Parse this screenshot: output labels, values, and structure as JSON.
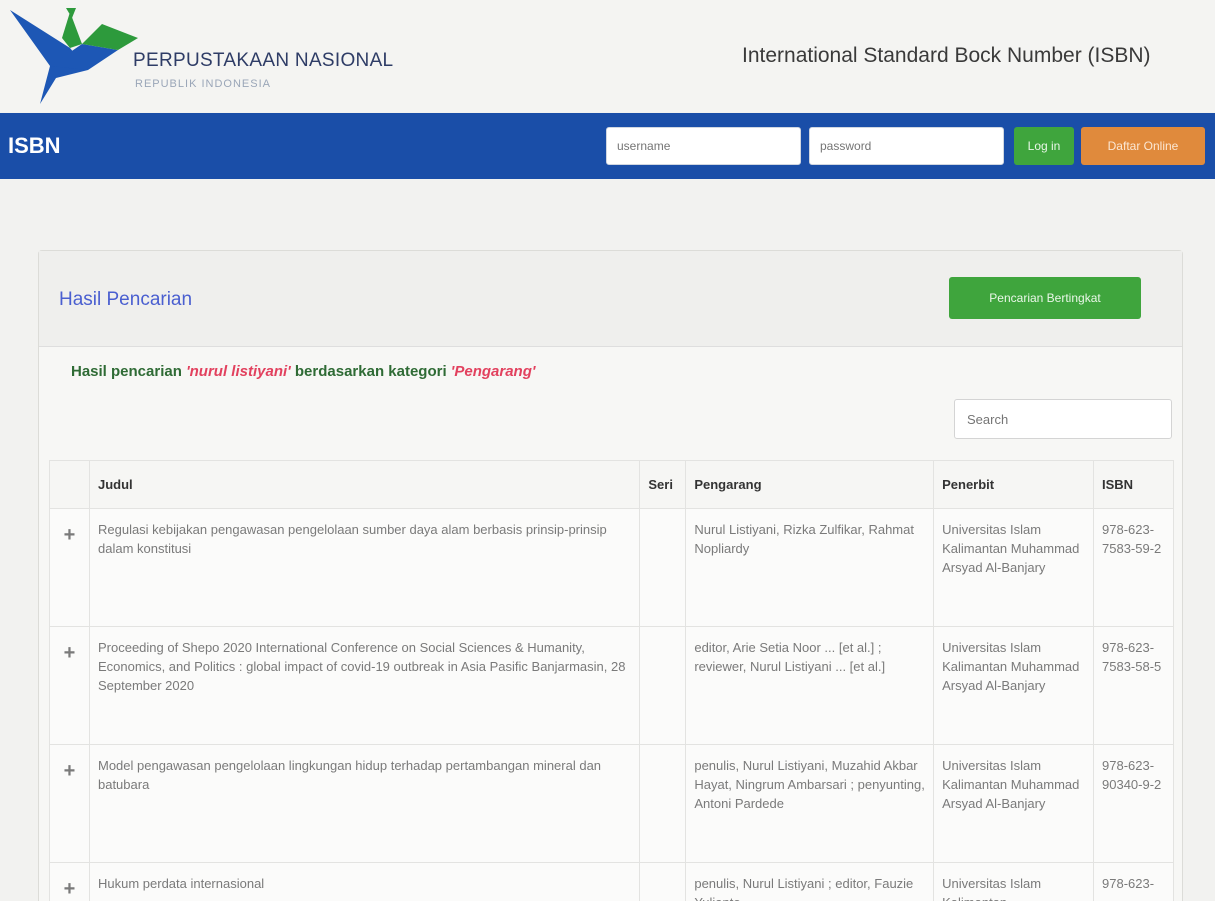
{
  "header": {
    "brand_title": "PERPUSTAKAAN NASIONAL",
    "brand_subtitle": "REPUBLIK INDONESIA",
    "site_title": "International Standard Bock Number (ISBN)"
  },
  "navbar": {
    "brand": "ISBN",
    "username_placeholder": "username",
    "password_placeholder": "password",
    "login_label": "Log in",
    "daftar_label": "Daftar Online"
  },
  "panel": {
    "title": "Hasil Pencarian",
    "advanced_button": "Pencarian Bertingkat",
    "result_prefix": "Hasil pencarian ",
    "query": "'nurul listiyani'",
    "result_middle": " berdasarkan kategori ",
    "category": "'Pengarang'",
    "search_placeholder": "Search"
  },
  "table": {
    "headers": {
      "judul": "Judul",
      "seri": "Seri",
      "pengarang": "Pengarang",
      "penerbit": "Penerbit",
      "isbn": "ISBN"
    },
    "expand_symbol": "+",
    "rows": [
      {
        "judul": "Regulasi kebijakan pengawasan pengelolaan sumber daya alam berbasis prinsip-prinsip dalam konstitusi",
        "seri": "",
        "pengarang": "Nurul Listiyani, Rizka Zulfikar, Rahmat Nopliardy",
        "penerbit": "Universitas Islam Kalimantan Muhammad Arsyad Al-Banjary",
        "isbn": "978-623-7583-59-2"
      },
      {
        "judul": "Proceeding of Shepo 2020 International Conference on Social Sciences & Humanity, Economics, and Politics : global impact of covid-19 outbreak in Asia Pasific Banjarmasin, 28 September 2020",
        "seri": "",
        "pengarang": "editor, Arie Setia Noor ... [et al.] ; reviewer, Nurul Listiyani ... [et al.]",
        "penerbit": "Universitas Islam Kalimantan Muhammad Arsyad Al-Banjary",
        "isbn": "978-623-7583-58-5"
      },
      {
        "judul": "Model pengawasan pengelolaan lingkungan hidup terhadap pertambangan mineral dan batubara",
        "seri": "",
        "pengarang": "penulis, Nurul Listiyani, Muzahid Akbar Hayat, Ningrum Ambarsari ; penyunting, Antoni Pardede",
        "penerbit": "Universitas Islam Kalimantan Muhammad Arsyad Al-Banjary",
        "isbn": "978-623-90340-9-2"
      },
      {
        "judul": "Hukum perdata internasional",
        "seri": "",
        "pengarang": "penulis, Nurul Listiyani ; editor, Fauzie Yulianto",
        "penerbit": "Universitas Islam Kalimantan",
        "isbn": "978-623-"
      }
    ]
  },
  "colors": {
    "navbar": "#1a4ea8",
    "green_button": "#3fa53d",
    "orange_button": "#e08a3c",
    "panel_title": "#4a5fd0",
    "highlight": "#e2415e"
  }
}
